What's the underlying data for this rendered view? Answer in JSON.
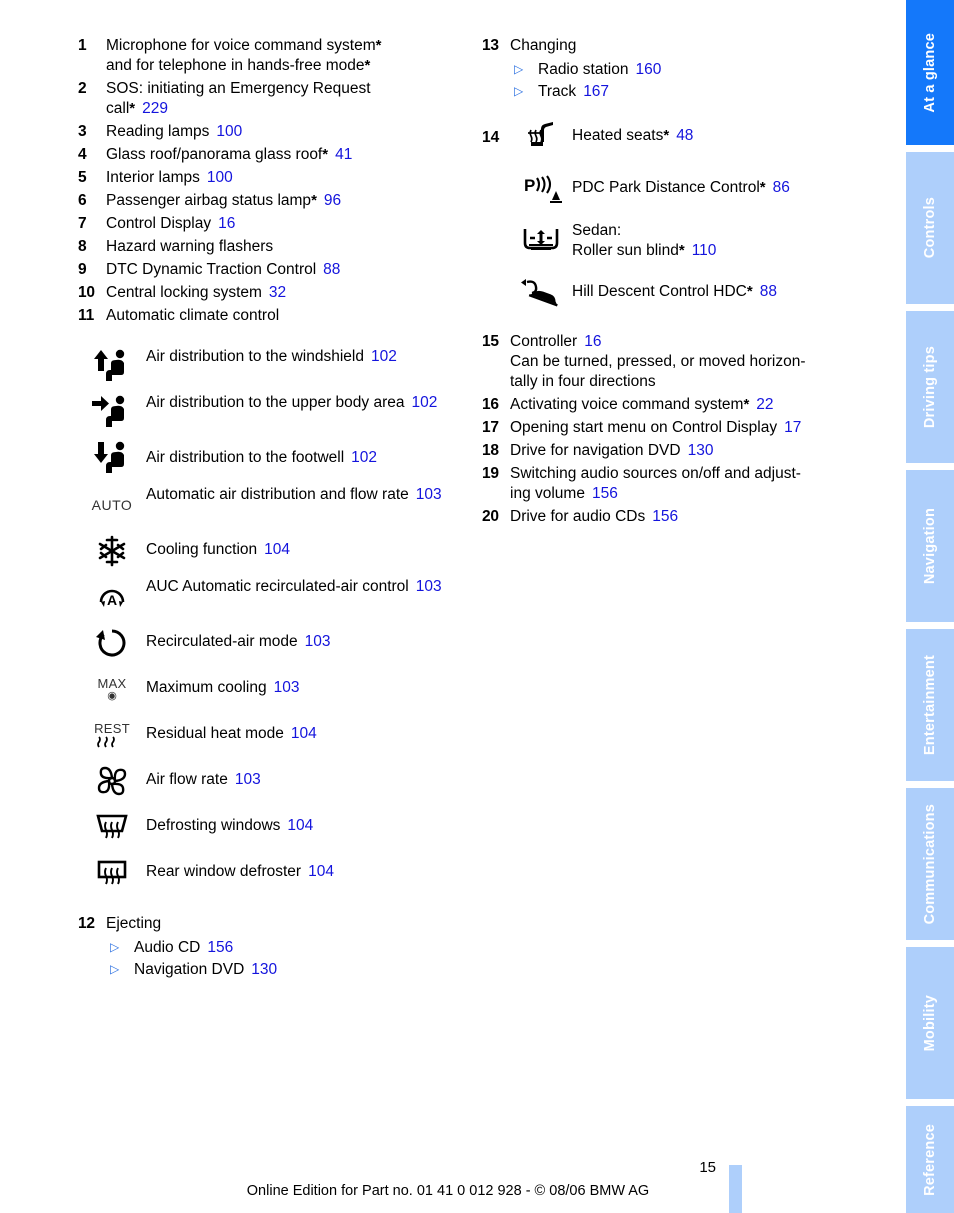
{
  "document": {
    "page_number": "15",
    "footer_text": "Online Edition for Part no. 01 41 0 012 928 - © 08/06 BMW AG"
  },
  "sidebar": {
    "tabs": [
      {
        "label": "At a glance",
        "active": true
      },
      {
        "label": "Controls",
        "active": false
      },
      {
        "label": "Driving tips",
        "active": false
      },
      {
        "label": "Navigation",
        "active": false
      },
      {
        "label": "Entertainment",
        "active": false
      },
      {
        "label": "Communications",
        "active": false
      },
      {
        "label": "Mobility",
        "active": false
      },
      {
        "label": "Reference",
        "active": false
      }
    ],
    "active_color": "#1478fa",
    "inactive_color": "#aecffb",
    "label_color": "#ffffff"
  },
  "colors": {
    "page_reference": "#1414dd",
    "bullet_triangle": "#2a6fe0",
    "text": "#000000"
  },
  "left_column": {
    "items": [
      {
        "num": "1",
        "text_line1": "Microphone for voice command system",
        "star1": "*",
        "text_line2": "and for telephone in hands-free mode",
        "star2": "*",
        "ref": ""
      },
      {
        "num": "2",
        "text_line1": "SOS: initiating an Emergency Request",
        "text_line2": "call",
        "star2": "*",
        "ref": "229"
      },
      {
        "num": "3",
        "text": "Reading lamps",
        "ref": "100"
      },
      {
        "num": "4",
        "text": "Glass roof/panorama glass roof",
        "star": "*",
        "ref": "41"
      },
      {
        "num": "5",
        "text": "Interior lamps",
        "ref": "100"
      },
      {
        "num": "6",
        "text": "Passenger airbag status lamp",
        "star": "*",
        "ref": "96"
      },
      {
        "num": "7",
        "text": "Control Display",
        "ref": "16"
      },
      {
        "num": "8",
        "text": "Hazard warning flashers",
        "ref": ""
      },
      {
        "num": "9",
        "text": "DTC Dynamic Traction Control",
        "ref": "88"
      },
      {
        "num": "10",
        "text": "Central locking system",
        "ref": "32"
      },
      {
        "num": "11",
        "text": "Automatic climate control",
        "ref": ""
      }
    ],
    "climate_symbols": [
      {
        "icon": "air-distribution-windshield-icon",
        "text": "Air distribution to the windshield",
        "ref": "102"
      },
      {
        "icon": "air-distribution-upper-body-icon",
        "text": "Air distribution to the upper body area",
        "ref": "102"
      },
      {
        "icon": "air-distribution-footwell-icon",
        "text": "Air distribution to the footwell",
        "ref": "102"
      },
      {
        "icon": "auto-climate-icon",
        "text": "Automatic air distribution and flow rate",
        "ref": "103"
      },
      {
        "icon": "cooling-snowflake-icon",
        "text": "Cooling function",
        "ref": "104"
      },
      {
        "icon": "auc-recirculated-air-icon",
        "text": "AUC Automatic recirculated-air control",
        "ref": "103"
      },
      {
        "icon": "recirculated-air-mode-icon",
        "text": "Recirculated-air mode",
        "ref": "103"
      },
      {
        "icon": "maximum-cooling-icon",
        "text": "Maximum cooling",
        "ref": "103"
      },
      {
        "icon": "residual-heat-icon",
        "text": "Residual heat mode",
        "ref": "104"
      },
      {
        "icon": "air-flow-rate-fan-icon",
        "text": "Air flow rate",
        "ref": "103"
      },
      {
        "icon": "defrosting-windows-icon",
        "text": "Defrosting windows",
        "ref": "104"
      },
      {
        "icon": "rear-window-defroster-icon",
        "text": "Rear window defroster",
        "ref": "104"
      }
    ],
    "item12": {
      "num": "12",
      "title": "Ejecting",
      "bullets": [
        {
          "text": "Audio CD",
          "ref": "156"
        },
        {
          "text": "Navigation DVD",
          "ref": "130"
        }
      ]
    },
    "icon_labels": {
      "auto": "AUTO",
      "max": "MAX",
      "rest": "REST",
      "auc": "A"
    }
  },
  "right_column": {
    "item13": {
      "num": "13",
      "title": "Changing",
      "bullets": [
        {
          "text": "Radio station",
          "ref": "160"
        },
        {
          "text": "Track",
          "ref": "167"
        }
      ]
    },
    "item14": {
      "num": "14",
      "symbols": [
        {
          "icon": "heated-seats-icon",
          "text": "Heated seats",
          "star": "*",
          "ref": "48"
        },
        {
          "icon": "pdc-park-distance-icon",
          "text": "PDC Park Distance Control",
          "star": "*",
          "ref": "86"
        },
        {
          "icon": "roller-sun-blind-icon",
          "text_line1": "Sedan:",
          "text": "Roller sun blind",
          "star": "*",
          "ref": "110"
        },
        {
          "icon": "hill-descent-control-icon",
          "text": "Hill Descent Control HDC",
          "star": "*",
          "ref": "88"
        }
      ]
    },
    "items": [
      {
        "num": "15",
        "text": "Controller",
        "ref": "16",
        "sub_line1": "Can be turned, pressed, or moved horizon-",
        "sub_line2": "tally in four directions"
      },
      {
        "num": "16",
        "text": "Activating voice command system",
        "star": "*",
        "ref": "22"
      },
      {
        "num": "17",
        "text": "Opening start menu on Control Display",
        "ref": "17"
      },
      {
        "num": "18",
        "text": "Drive for navigation DVD",
        "ref": "130"
      },
      {
        "num": "19",
        "text_line1": "Switching audio sources on/off and adjust-",
        "text_line2": "ing volume",
        "ref": "156"
      },
      {
        "num": "20",
        "text": "Drive for audio CDs",
        "ref": "156"
      }
    ]
  }
}
